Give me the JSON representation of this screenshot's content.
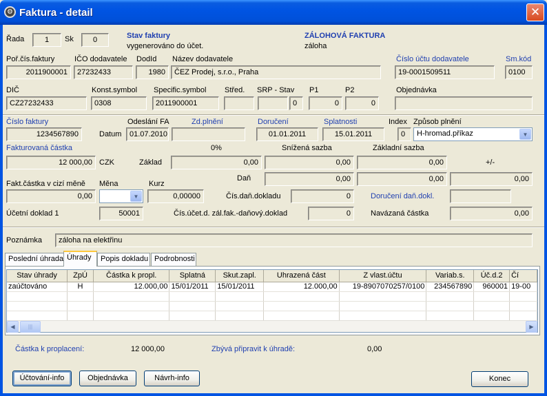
{
  "window": {
    "title": "Faktura - detail",
    "close": "✕"
  },
  "head": {
    "rada_label": "Řada",
    "rada": "1",
    "sk_label": "Sk",
    "sk": "0",
    "stav_label": "Stav faktury",
    "stav": "vygenerováno do účet.",
    "typ_label": "ZÁLOHOVÁ FAKTURA",
    "typ": "záloha"
  },
  "row1": {
    "porcis_label": "Poř.čís.faktury",
    "porcis": "2011900001",
    "ico_label": "IČO dodavatele",
    "ico": "27232433",
    "dodid_label": "DodId",
    "dodid": "1980",
    "nazev_label": "Název dodavatele",
    "nazev": "ČEZ Prodej, s.r.o., Praha",
    "ucet_label": "Číslo účtu  dodavatele",
    "ucet": "19-0001509511",
    "smkod_label": "Sm.kód",
    "smkod": "0100"
  },
  "row2": {
    "dic_label": "DIČ",
    "dic": "CZ27232433",
    "konst_label": "Konst.symbol",
    "konst": "0308",
    "spec_label": "Specific.symbol",
    "spec": "2011900001",
    "stred_label": "Střed.",
    "stred": "",
    "srp_label": "SRP -  Stav",
    "srp": "",
    "srp_stav": "0",
    "p1_label": "P1",
    "p1": "0",
    "p2_label": "P2",
    "p2": "0",
    "obj_label": "Objednávka",
    "obj": ""
  },
  "row3": {
    "cislo_label": "Číslo faktury",
    "cislo": "1234567890",
    "datum_label": "Datum",
    "odeslani_label": "Odeslání FA",
    "odeslani": "01.07.2010",
    "zdpl_label": "Zd.plnění",
    "zdpl": "",
    "doruceni_label": "Doručení",
    "doruceni": "01.01.2011",
    "splatnost_label": "Splatnosti",
    "splatnost": "15.01.2011",
    "index_label": "Index",
    "index": "0",
    "zpusob_label": "Způsob plnění",
    "zpusob": "H-hromad.příkaz"
  },
  "amounts": {
    "fakt_label": "Fakturovaná částka",
    "fakt": "12 000,00",
    "currency": "CZK",
    "zaklad_label": "Základ",
    "dan_label": "Daň",
    "pct0_label": "0%",
    "snizena_label": "Snížená sazba",
    "zakladni_label": "Základní sazba",
    "plusminus_label": "+/-",
    "zaklad0": "0,00",
    "zaklad_sniz": "0,00",
    "zaklad_zakl": "0,00",
    "dan_sniz": "0,00",
    "dan_zakl": "0,00",
    "plusminus": "0,00",
    "cizi_label": "Fakt.částka v cizí měně",
    "cizi": "0,00",
    "mena_label": "Měna",
    "mena": "",
    "kurz_label": "Kurz",
    "kurz": "0,00000",
    "cisdan_label": "Čís.daň.dokladu",
    "cisdan": "0",
    "dordan_label": "Doručení daň.dokl.",
    "dordan": "",
    "ucdok_label": "Účetní doklad 1",
    "ucdok": "50001",
    "cisuc_label": "Čís.účet.d. zál.fak.-daňový.doklad",
    "cisuc": "0",
    "navaz_label": "Navázaná částka",
    "navaz": "0,00"
  },
  "note": {
    "label": "Poznámka",
    "value": "záloha na elektřinu"
  },
  "tabs": [
    {
      "label": "Poslední úhrada"
    },
    {
      "label": "Úhrady"
    },
    {
      "label": "Popis dokladu"
    },
    {
      "label": "Podrobnosti"
    }
  ],
  "grid": {
    "columns": [
      "Stav  úhrady",
      "ZpÚ",
      "Částka k propl.",
      "Splatná",
      "Skut.zapl.",
      "Uhrazená část",
      "Z vlast.účtu",
      "Variab.s.",
      "Úč.d.2",
      "Čí"
    ],
    "rows": [
      [
        "zaúčtováno",
        "H",
        "12.000,00",
        "15/01/2011",
        "15/01/2011",
        "12.000,00",
        "19-8907070257/0100",
        "234567890",
        "960001",
        "19-00"
      ]
    ]
  },
  "summary": {
    "kprop_label": "Částka k proplacení:",
    "kprop": "12 000,00",
    "zbyva_label": "Zbývá připravit k úhradě:",
    "zbyva": "0,00"
  },
  "buttons": {
    "uctovani": "Účtování-info",
    "objednavka": "Objednávka",
    "navrh": "Návrh-info",
    "konec": "Konec"
  }
}
